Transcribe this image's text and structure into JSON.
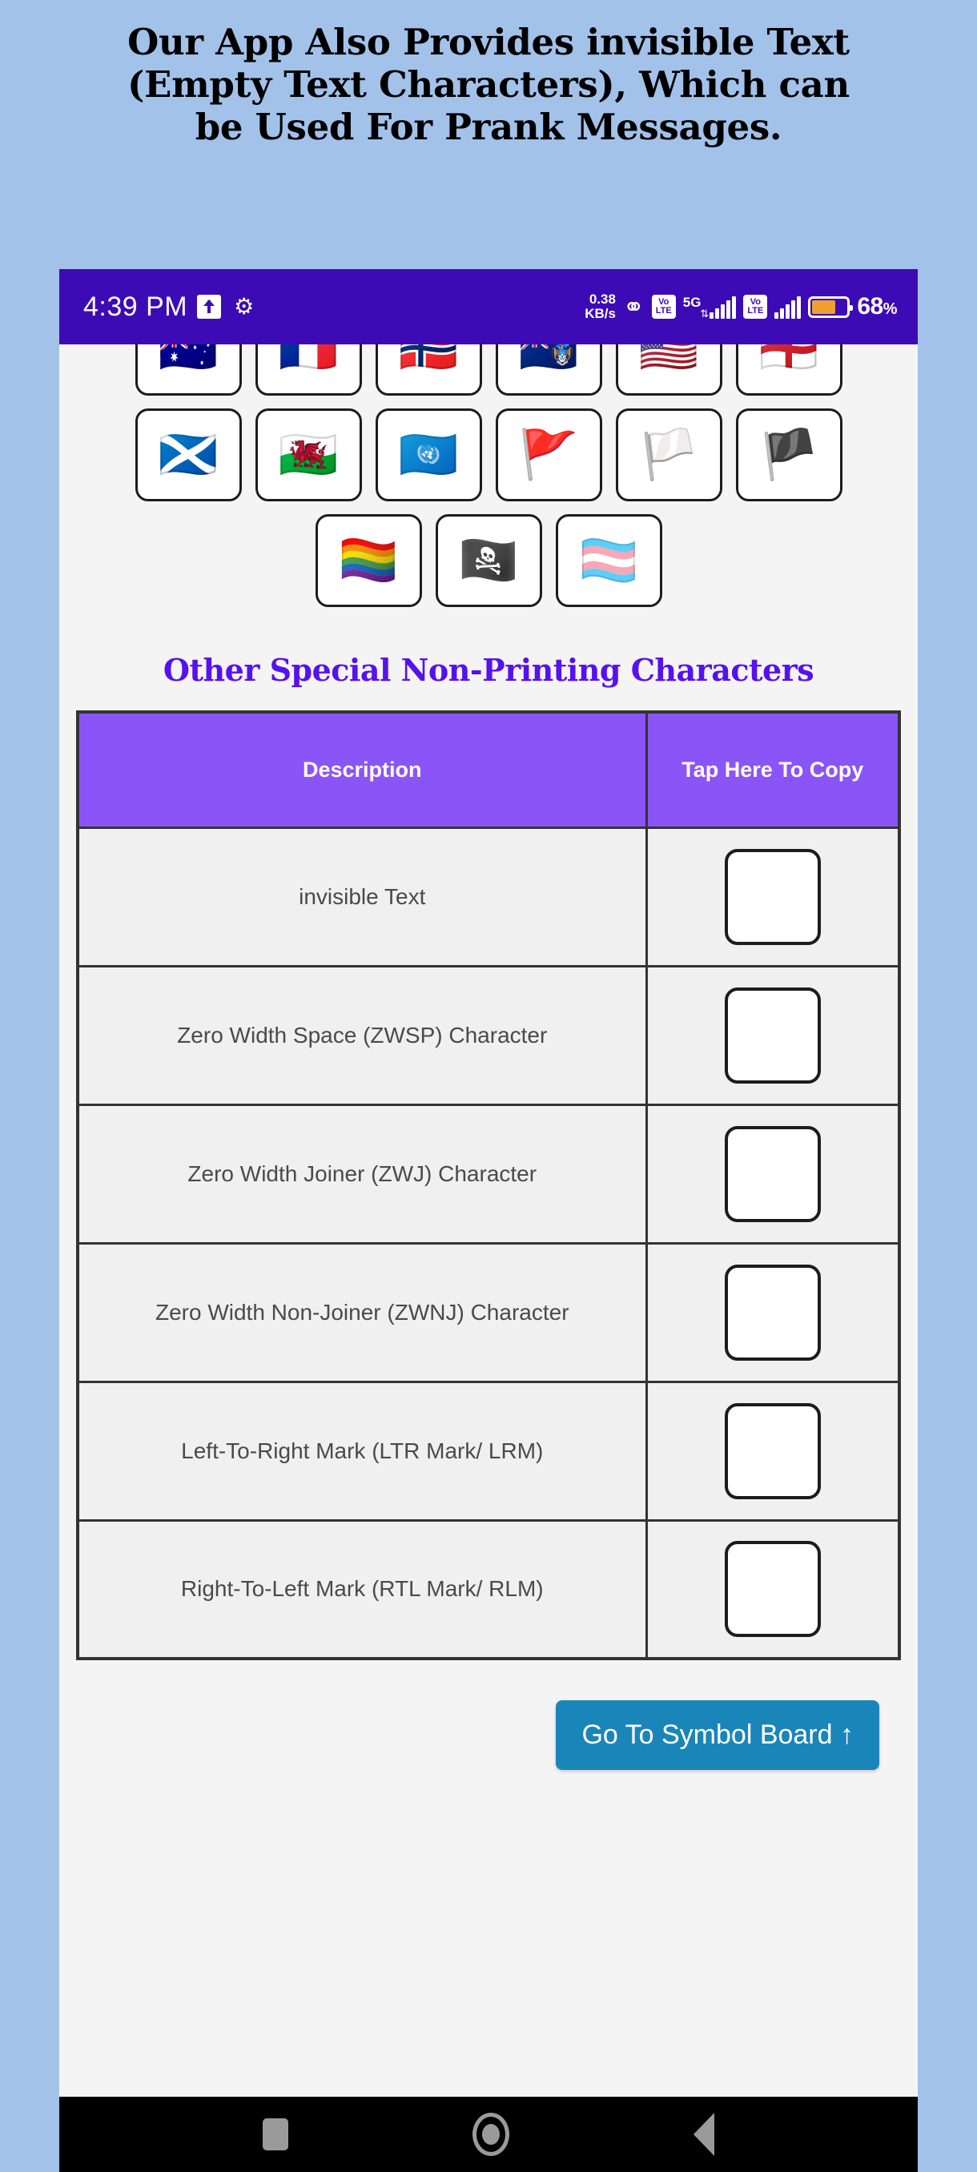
{
  "promo": {
    "lines": [
      "Our App Also Provides invisible Text",
      "(Empty Text Characters), Which can",
      "be Used For Prank Messages."
    ]
  },
  "status_bar": {
    "time": "4:39 PM",
    "upload_icon": "upload-arrow-icon",
    "settings_icon": "gear-icon",
    "data_rate": "0.38",
    "data_rate_unit": "KB/s",
    "link_icon": "link-icon",
    "volte_line1": "Vo",
    "volte_line2": "LTE",
    "network_type": "5G",
    "data_arrows": "⇅",
    "battery_percent": "68",
    "percent_symbol": "%",
    "battery_level": 68,
    "bg_color": "#3d0bb5"
  },
  "flags": {
    "row1": [
      {
        "name": "flag-australia",
        "glyph": "🇦🇺"
      },
      {
        "name": "flag-france",
        "glyph": "🇫🇷"
      },
      {
        "name": "flag-norway",
        "glyph": "🇳🇴"
      },
      {
        "name": "flag-tristan-da-cunha",
        "glyph": "🇹🇦"
      },
      {
        "name": "flag-united-states",
        "glyph": "🇺🇸"
      },
      {
        "name": "flag-england",
        "glyph": "🏴󠁧󠁢󠁥󠁮󠁧󠁿"
      }
    ],
    "row2": [
      {
        "name": "flag-scotland",
        "glyph": "🏴󠁧󠁢󠁳󠁣󠁴󠁿"
      },
      {
        "name": "flag-wales",
        "glyph": "🏴󠁧󠁢󠁷󠁬󠁳󠁿"
      },
      {
        "name": "flag-united-nations",
        "glyph": "🇺🇳"
      },
      {
        "name": "flag-triangular-red",
        "glyph": "🚩"
      },
      {
        "name": "flag-white",
        "glyph": "🏳️"
      },
      {
        "name": "flag-black",
        "glyph": "🏴"
      }
    ],
    "row3": [
      {
        "name": "flag-rainbow",
        "glyph": "🏳️‍🌈"
      },
      {
        "name": "flag-pirate",
        "glyph": "🏴‍☠️"
      },
      {
        "name": "flag-transgender",
        "glyph": "🏳️‍⚧️"
      }
    ]
  },
  "section": {
    "title": "Other Special Non-Printing Characters",
    "title_color": "#5611ef"
  },
  "table": {
    "header_bg": "#8b54f7",
    "columns": [
      "Description",
      "Tap Here To Copy"
    ],
    "rows": [
      {
        "description": "invisible Text",
        "copy_label": ""
      },
      {
        "description": "Zero Width Space (ZWSP) Character",
        "copy_label": ""
      },
      {
        "description": "Zero Width Joiner (ZWJ) Character",
        "copy_label": ""
      },
      {
        "description": "Zero Width Non-Joiner (ZWNJ) Character",
        "copy_label": ""
      },
      {
        "description": "Left-To-Right Mark (LTR Mark/ LRM)",
        "copy_label": ""
      },
      {
        "description": "Right-To-Left Mark (RTL Mark/ RLM)",
        "copy_label": ""
      }
    ]
  },
  "footer": {
    "button_label": "Go To Symbol Board ↑",
    "button_color": "#1a85b8"
  },
  "navbar": {
    "recents": "recents-square-icon",
    "home": "home-circle-icon",
    "back": "back-triangle-icon"
  }
}
